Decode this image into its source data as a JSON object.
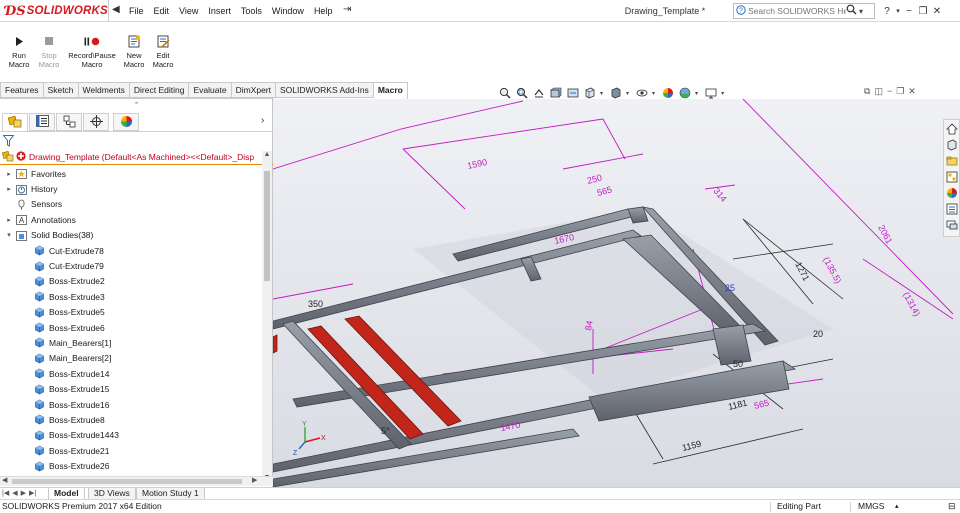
{
  "app": {
    "brand": "SOLIDWORKS",
    "document_title": "Drawing_Template *"
  },
  "menu": {
    "items": [
      "File",
      "Edit",
      "View",
      "Insert",
      "Tools",
      "Window",
      "Help"
    ]
  },
  "search": {
    "placeholder": "Search SOLIDWORKS Help"
  },
  "macro_toolbar": {
    "buttons": [
      {
        "label_line1": "Run",
        "label_line2": "Macro",
        "enabled": true
      },
      {
        "label_line1": "Stop",
        "label_line2": "Macro",
        "enabled": false
      },
      {
        "label_line1": "Record\\Pause",
        "label_line2": "Macro",
        "enabled": true
      },
      {
        "label_line1": "New",
        "label_line2": "Macro",
        "enabled": true
      },
      {
        "label_line1": "Edit",
        "label_line2": "Macro",
        "enabled": true
      }
    ]
  },
  "command_tabs": {
    "tabs": [
      "Features",
      "Sketch",
      "Weldments",
      "Direct Editing",
      "Evaluate",
      "DimXpert",
      "SOLIDWORKS Add-Ins",
      "Macro"
    ],
    "active": "Macro"
  },
  "feature_tree": {
    "root": "Drawing_Template  (Default<As Machined><<Default>_Disp",
    "top_items": [
      "Favorites",
      "History",
      "Sensors",
      "Annotations",
      "Solid Bodies(38)"
    ],
    "bodies": [
      "Cut-Extrude78",
      "Cut-Extrude79",
      "Boss-Extrude2",
      "Boss-Extrude3",
      "Boss-Extrude5",
      "Boss-Extrude6",
      "Main_Bearers[1]",
      "Main_Bearers[2]",
      "Boss-Extrude14",
      "Boss-Extrude15",
      "Boss-Extrude16",
      "Boss-Extrude8",
      "Boss-Extrude1443",
      "Boss-Extrude21",
      "Boss-Extrude26"
    ]
  },
  "viewport": {
    "dimensions": [
      "1590",
      "250",
      "565",
      "314",
      "2061",
      "1271",
      "(135.5)",
      "(1314)",
      "25",
      "350",
      "1670",
      "1470",
      "1159",
      "1181",
      "565",
      "84",
      "20",
      "50",
      "5°"
    ],
    "axis_labels": [
      "X",
      "Y",
      "Z"
    ]
  },
  "bottom_tabs": {
    "tabs": [
      "Model",
      "3D Views",
      "Motion Study 1"
    ],
    "active": "Model"
  },
  "status": {
    "edition": "SOLIDWORKS Premium 2017 x64 Edition",
    "mode": "Editing Part",
    "units": "MMGS"
  }
}
